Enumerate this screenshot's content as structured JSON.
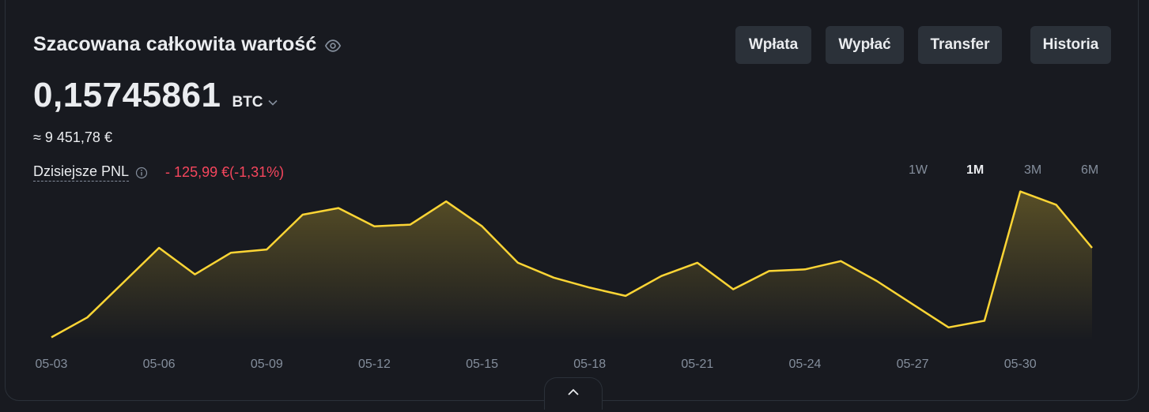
{
  "header": {
    "title": "Szacowana całkowita wartość",
    "balance": "0,15745861",
    "unit": "BTC",
    "fiat": "≈ 9 451,78 €",
    "pnl_label": "Dzisiejsze PNL",
    "pnl_value": "- 125,99 €(-1,31%)"
  },
  "actions": {
    "deposit": "Wpłata",
    "withdraw": "Wypłać",
    "transfer": "Transfer",
    "history": "Historia"
  },
  "ranges": [
    {
      "label": "1W",
      "active": false
    },
    {
      "label": "1M",
      "active": true
    },
    {
      "label": "3M",
      "active": false
    },
    {
      "label": "6M",
      "active": false
    }
  ],
  "icons": {
    "eye": "eye-icon",
    "chevron": "chevron-down-icon",
    "info": "info-icon",
    "collapse": "chevron-up-icon"
  },
  "colors": {
    "line": "#fcd535",
    "negative": "#f6465d",
    "muted": "#848e9c"
  },
  "chart_data": {
    "type": "area",
    "x": [
      "05-03",
      "05-04",
      "05-05",
      "05-06",
      "05-07",
      "05-08",
      "05-09",
      "05-10",
      "05-11",
      "05-12",
      "05-13",
      "05-14",
      "05-15",
      "05-16",
      "05-17",
      "05-18",
      "05-19",
      "05-20",
      "05-21",
      "05-22",
      "05-23",
      "05-24",
      "05-25",
      "05-26",
      "05-27",
      "05-28",
      "05-29",
      "05-30",
      "05-31",
      "06-01"
    ],
    "tick_labels": [
      "05-03",
      "05-06",
      "05-09",
      "05-12",
      "05-15",
      "05-18",
      "05-21",
      "05-24",
      "05-27",
      "05-30"
    ],
    "tick_indices": [
      0,
      3,
      6,
      9,
      12,
      15,
      18,
      21,
      24,
      27
    ],
    "series": [
      {
        "values": [
          0.1501,
          0.1513,
          0.1534,
          0.1555,
          0.1539,
          0.1552,
          0.1554,
          0.1575,
          0.1579,
          0.1568,
          0.1569,
          0.1583,
          0.1568,
          0.1546,
          0.1537,
          0.1531,
          0.1526,
          0.1538,
          0.1546,
          0.153,
          0.1541,
          0.1542,
          0.1547,
          0.1535,
          0.1521,
          0.1507,
          0.1511,
          0.1589,
          0.1581,
          0.1555
        ]
      }
    ],
    "ylim": [
      0.1495,
      0.1595
    ],
    "grid": false
  }
}
